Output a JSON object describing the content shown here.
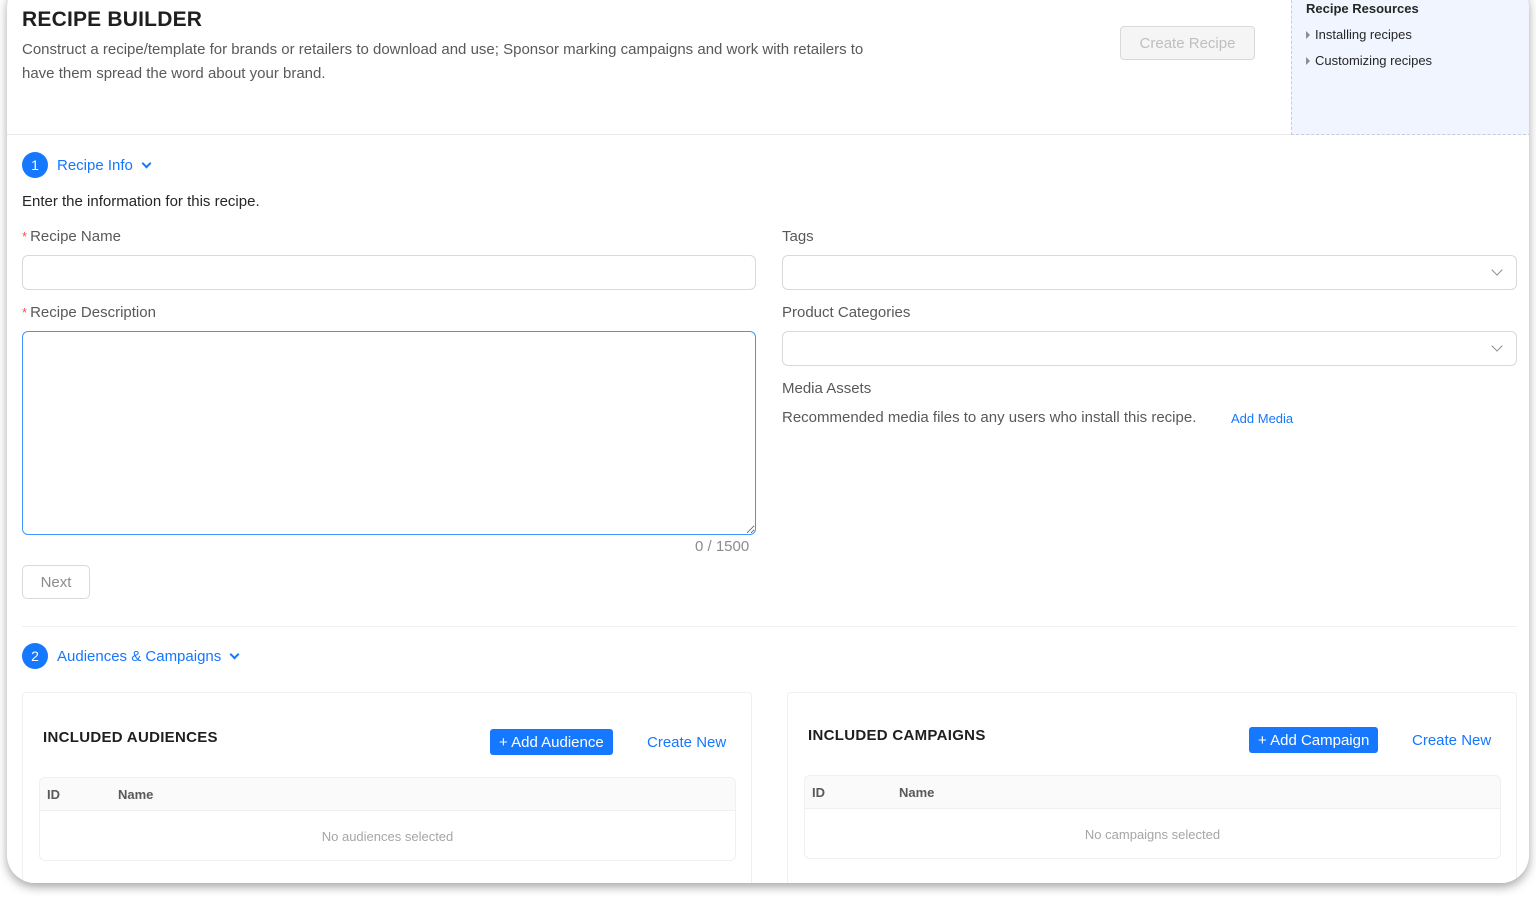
{
  "header": {
    "title": "RECIPE BUILDER",
    "description": "Construct a recipe/template for brands or retailers to download and use; Sponsor marking campaigns and work with retailers to have them spread the word about your brand.",
    "create_button": "Create Recipe"
  },
  "resources": {
    "title": "Recipe Resources",
    "items": [
      "Installing recipes",
      "Customizing recipes"
    ]
  },
  "step1": {
    "number": "1",
    "label": "Recipe Info",
    "intro": "Enter the information for this recipe.",
    "recipe_name_label": "Recipe Name",
    "recipe_name_value": "",
    "recipe_description_label": "Recipe Description",
    "recipe_description_value": "",
    "required_mark": "*",
    "counter": "0 / 1500",
    "tags_label": "Tags",
    "product_categories_label": "Product Categories",
    "media_assets_label": "Media Assets",
    "media_assets_desc": "Recommended media files to any users who install this recipe.",
    "add_media": "Add Media",
    "next_button": "Next"
  },
  "step2": {
    "number": "2",
    "label": "Audiences & Campaigns",
    "audiences": {
      "title": "INCLUDED AUDIENCES",
      "add_button": "+ Add Audience",
      "create_new": "Create New",
      "columns": [
        "ID",
        "Name"
      ],
      "empty": "No audiences selected"
    },
    "campaigns": {
      "title": "INCLUDED CAMPAIGNS",
      "add_button": "+ Add Campaign",
      "create_new": "Create New",
      "columns": [
        "ID",
        "Name"
      ],
      "empty": "No campaigns selected"
    }
  },
  "colors": {
    "primary": "#1677ff",
    "required": "#ff4d4f",
    "resources_bg": "#f0f5ff"
  }
}
